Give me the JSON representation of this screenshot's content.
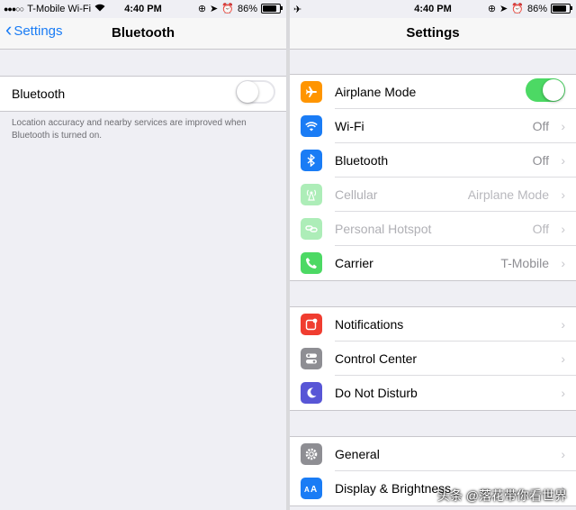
{
  "left": {
    "status": {
      "carrier": "T-Mobile Wi-Fi",
      "time": "4:40 PM",
      "battery": "86%"
    },
    "nav": {
      "back_label": "Settings",
      "title": "Bluetooth"
    },
    "bluetooth_row": {
      "label": "Bluetooth",
      "on": false
    },
    "footer_text": "Location accuracy and nearby services are improved when Bluetooth is turned on."
  },
  "right": {
    "status": {
      "time": "4:40 PM",
      "battery": "86%"
    },
    "nav": {
      "title": "Settings"
    },
    "groups": [
      [
        {
          "label": "Airplane Mode",
          "value": "",
          "icon": "airplane-icon",
          "color": "#ff9500",
          "toggle": true
        },
        {
          "label": "Wi-Fi",
          "value": "Off",
          "icon": "wifi-icon",
          "color": "#1a7cf5"
        },
        {
          "label": "Bluetooth",
          "value": "Off",
          "icon": "bluetooth-icon",
          "color": "#1a7cf5"
        },
        {
          "label": "Cellular",
          "value": "Airplane Mode",
          "icon": "cellular-icon",
          "color": "#4cd964",
          "dim": true
        },
        {
          "label": "Personal Hotspot",
          "value": "Off",
          "icon": "hotspot-icon",
          "color": "#4cd964",
          "dim": true
        },
        {
          "label": "Carrier",
          "value": "T-Mobile",
          "icon": "phone-icon",
          "color": "#4cd964"
        }
      ],
      [
        {
          "label": "Notifications",
          "value": "",
          "icon": "notifications-icon",
          "color": "#f03d30"
        },
        {
          "label": "Control Center",
          "value": "",
          "icon": "control-center-icon",
          "color": "#8e8e93"
        },
        {
          "label": "Do Not Disturb",
          "value": "",
          "icon": "moon-icon",
          "color": "#5856d6"
        }
      ],
      [
        {
          "label": "General",
          "value": "",
          "icon": "gear-icon",
          "color": "#8e8e93"
        },
        {
          "label": "Display & Brightness",
          "value": "",
          "icon": "display-icon",
          "color": "#1a7cf5"
        }
      ]
    ]
  },
  "watermark": "头条 @落花带你看世界"
}
